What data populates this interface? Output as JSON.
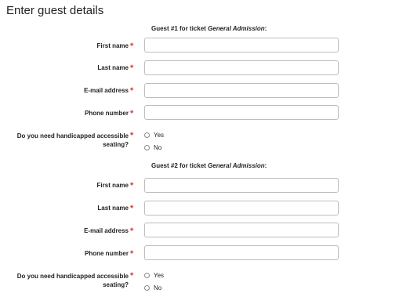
{
  "page": {
    "title": "Enter guest details"
  },
  "guests": [
    {
      "heading_prefix": "Guest #1 for ticket ",
      "ticket_type": "General Admission",
      "heading_suffix": ":",
      "first_name_label": "First name",
      "last_name_label": "Last name",
      "email_label": "E-mail address",
      "phone_label": "Phone number",
      "first_name_value": "",
      "last_name_value": "",
      "email_value": "",
      "phone_value": "",
      "handicap_question": "Do you need handicapped accessible seating?",
      "option_yes": "Yes",
      "option_no": "No",
      "required_marker": "*"
    },
    {
      "heading_prefix": "Guest #2 for ticket ",
      "ticket_type": "General Admission",
      "heading_suffix": ":",
      "first_name_label": "First name",
      "last_name_label": "Last name",
      "email_label": "E-mail address",
      "phone_label": "Phone number",
      "first_name_value": "",
      "last_name_value": "",
      "email_value": "",
      "phone_value": "",
      "handicap_question": "Do you need handicapped accessible seating?",
      "option_yes": "Yes",
      "option_no": "No",
      "required_marker": "*"
    }
  ],
  "colors": {
    "required": "#d13b3b",
    "input_border": "#bdbdbd"
  }
}
